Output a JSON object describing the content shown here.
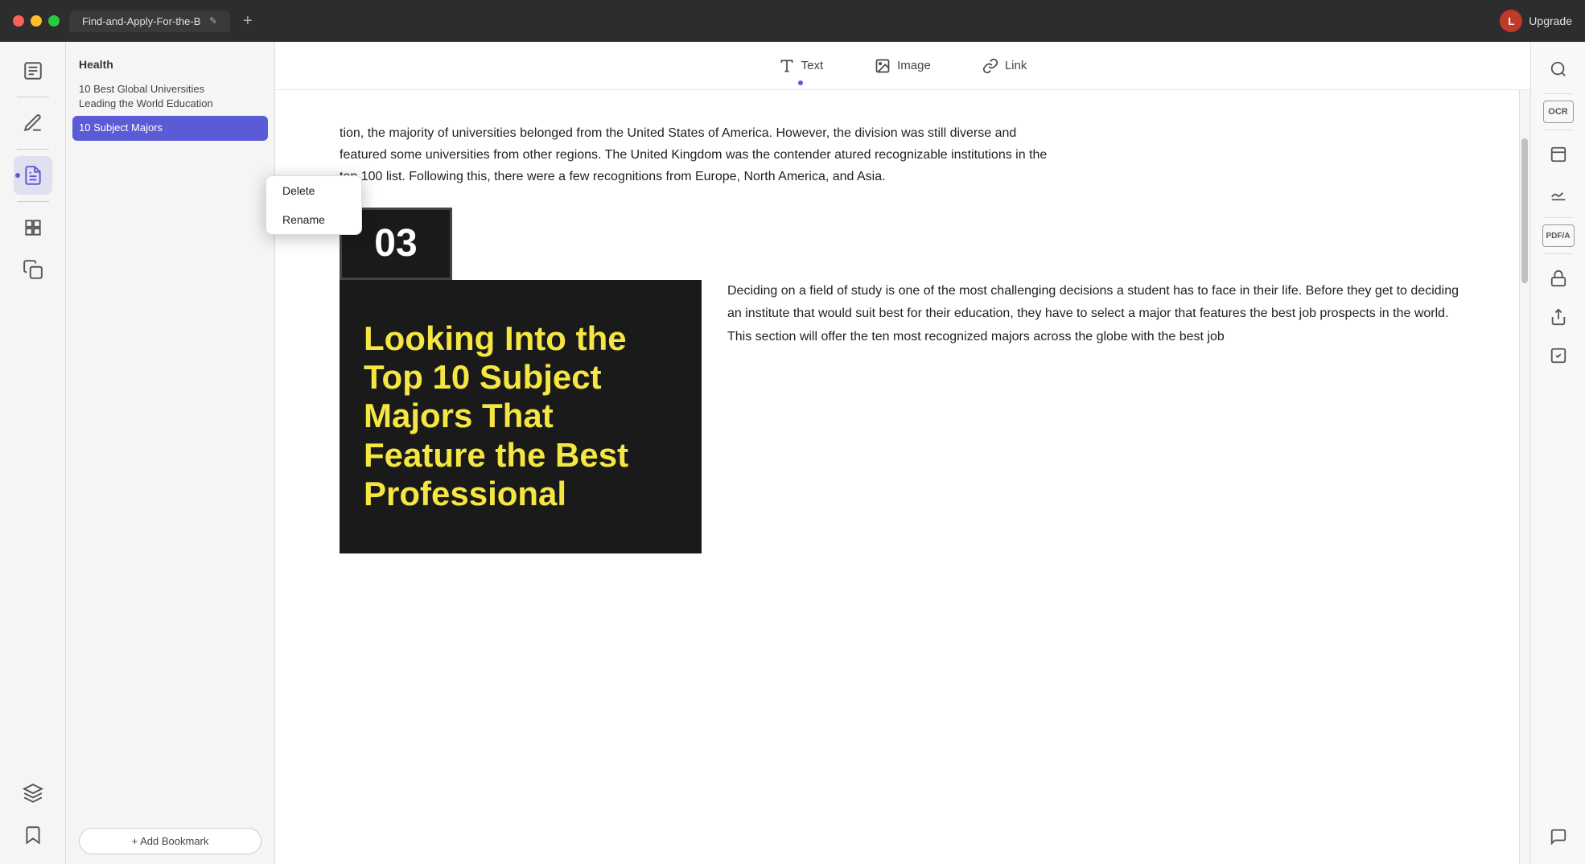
{
  "titlebar": {
    "tab_title": "Find-and-Apply-For-the-B",
    "upgrade_label": "Upgrade",
    "upgrade_initial": "L",
    "add_tab_label": "+"
  },
  "left_sidebar": {
    "icons": [
      {
        "name": "bookmarks-icon",
        "symbol": "📋",
        "active": false
      },
      {
        "name": "annotate-icon",
        "symbol": "✏️",
        "active": false
      },
      {
        "name": "notes-icon",
        "symbol": "📝",
        "active": true
      },
      {
        "name": "pages-icon",
        "symbol": "📄",
        "active": false
      },
      {
        "name": "layers-icon",
        "symbol": "⬛",
        "active": false
      },
      {
        "name": "copies-icon",
        "symbol": "📑",
        "active": false
      }
    ]
  },
  "bookmark_sidebar": {
    "category": "Health",
    "items": [
      {
        "label": "10 Best Global Universities\nLeading the World Education",
        "active": false
      },
      {
        "label": "10 Subject Majors",
        "active": true
      }
    ],
    "add_bookmark_label": "+ Add Bookmark"
  },
  "context_menu": {
    "items": [
      {
        "label": "Delete"
      },
      {
        "label": "Rename"
      }
    ]
  },
  "toolbar": {
    "items": [
      {
        "name": "text-tool",
        "icon": "T",
        "label": "Text"
      },
      {
        "name": "image-tool",
        "icon": "🖼",
        "label": "Image"
      },
      {
        "name": "link-tool",
        "icon": "🔗",
        "label": "Link"
      }
    ],
    "active_item": "text-tool"
  },
  "document": {
    "paragraph1": "tion, the majority of universities belonged from the United States of America. However, the division was still diverse and featured some universities from other regions. The United Kingdom was the contender atured recognizable institutions in the top 100 list. Following this, there were a few recognitions from Europe, North America, and Asia.",
    "section_number": "03",
    "feature_heading": "Looking Into the Top 10 Subject Majors That Feature the Best Professional",
    "feature_desc": "Deciding on a field of study is one of the most challenging decisions a student has to face in their life. Before they get to deciding an institute that would suit best for their education, they have to select a major that features the best job prospects in the world. This section will offer the ten most recognized majors across the globe with the best job"
  },
  "right_sidebar": {
    "icons": [
      {
        "name": "search-icon",
        "symbol": "🔍"
      },
      {
        "name": "ocr-icon",
        "label": "OCR"
      },
      {
        "name": "collapse-icon",
        "symbol": "▬"
      },
      {
        "name": "signature-icon",
        "symbol": "✍"
      },
      {
        "name": "pdfa-icon",
        "label": "PDF/A"
      },
      {
        "name": "lock-icon",
        "symbol": "🔒"
      },
      {
        "name": "share-icon",
        "symbol": "↑"
      },
      {
        "name": "check-icon",
        "symbol": "✓"
      },
      {
        "name": "chat-icon",
        "symbol": "💬"
      }
    ]
  }
}
